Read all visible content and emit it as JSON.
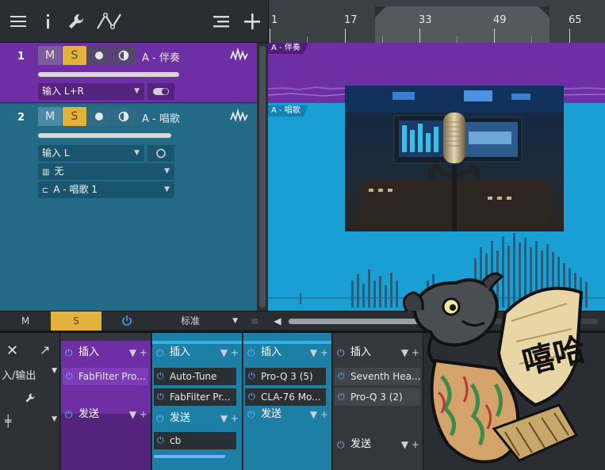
{
  "toolbar": {
    "icons": [
      "menu-icon",
      "info-icon",
      "wrench-icon",
      "automation-icon",
      "list-icon",
      "add-icon"
    ]
  },
  "ruler": {
    "marks": [
      "1",
      "17",
      "33",
      "49",
      "65"
    ]
  },
  "tracks": [
    {
      "number": "1",
      "name": "A - 伴奏",
      "mute": "M",
      "solo": "S",
      "input": "输入 L+R",
      "lane_label": "A - 伴奏",
      "color": "#6d2fa3"
    },
    {
      "number": "2",
      "name": "A - 唱歌",
      "mute": "M",
      "solo": "S",
      "input": "输入 L",
      "output": "无",
      "instrument": "A - 唱歌 1",
      "lane_label": "A - 唱歌",
      "color": "#236a86"
    }
  ],
  "strip": {
    "mute": "M",
    "solo": "S",
    "mode": "标准"
  },
  "mixer": {
    "left": {
      "io_label": "入/输出"
    },
    "channels": [
      {
        "insert_label": "插入",
        "inserts": [
          "FabFilter Pro..."
        ],
        "send_label": "发送",
        "sends": [],
        "color": "#6d2fa3"
      },
      {
        "insert_label": "插入",
        "inserts": [
          "Auto-Tune",
          "FabFilter Pr..."
        ],
        "send_label": "发送",
        "sends": [
          "cb"
        ],
        "color": "#1e7fa6"
      },
      {
        "insert_label": "插入",
        "inserts": [
          "Pro-Q 3 (5)",
          "CLA-76 Mo..."
        ],
        "send_label": "发送",
        "sends": [],
        "color": "#1e7fa6"
      },
      {
        "insert_label": "插入",
        "inserts": [
          "Seventh Hea...",
          "Pro-Q 3 (2)"
        ],
        "send_label": "发送",
        "sends": [],
        "color": "#33383d"
      }
    ]
  },
  "sticker": {
    "text": "嘻哈"
  },
  "colors": {
    "purple": "#6d2fa3",
    "teal": "#236a86",
    "lane_blue": "#1a9fd5",
    "solo_yellow": "#e3b23c",
    "power_blue": "#6fb0ff"
  }
}
